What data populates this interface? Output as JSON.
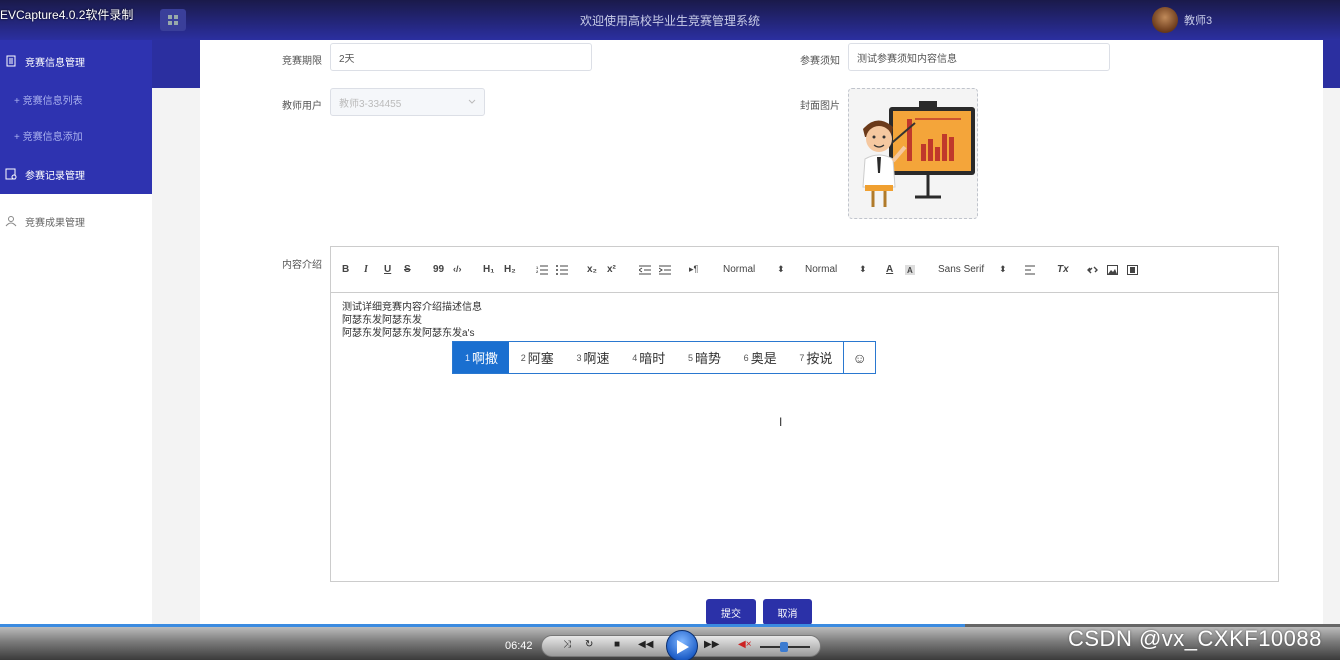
{
  "recorder": {
    "title": "EVCapture4.0.2软件录制"
  },
  "header": {
    "welcome": "欢迎使用高校毕业生竞赛管理系统",
    "user": "教师3"
  },
  "sidebar": {
    "items": [
      {
        "label": "竞赛信息管理"
      },
      {
        "label": "+ 竞赛信息列表"
      },
      {
        "label": "+ 竞赛信息添加"
      },
      {
        "label": "参赛记录管理"
      },
      {
        "label": "竞赛成果管理"
      }
    ]
  },
  "form": {
    "period_label": "竞赛期限",
    "period_value": "2天",
    "notice_label": "参赛须知",
    "notice_value": "测试参赛须知内容信息",
    "teacher_label": "教师用户",
    "teacher_value": "教师3-334455",
    "cover_label": "封面图片",
    "content_label": "内容介绍"
  },
  "editor": {
    "toolbar": {
      "bold": "B",
      "italic": "I",
      "underline": "U",
      "strike": "S",
      "quote": "99",
      "code": "‹/›",
      "h1": "H₁",
      "h2": "H₂",
      "sub": "x₂",
      "sup": "x²",
      "dir": "▸¶",
      "size": "Normal",
      "header": "Normal",
      "font": "Sans Serif",
      "color": "A",
      "clean": "Tx"
    },
    "lines": [
      "测试详细竞赛内容介绍描述信息",
      "阿瑟东发阿瑟东发",
      "阿瑟东发阿瑟东发阿瑟东发a's"
    ]
  },
  "ime": {
    "candidates": [
      {
        "num": "1",
        "text": "啊撒"
      },
      {
        "num": "2",
        "text": "阿塞"
      },
      {
        "num": "3",
        "text": "啊速"
      },
      {
        "num": "4",
        "text": "暗时"
      },
      {
        "num": "5",
        "text": "暗势"
      },
      {
        "num": "6",
        "text": "奥是"
      },
      {
        "num": "7",
        "text": "按说"
      }
    ]
  },
  "buttons": {
    "submit": "提交",
    "cancel": "取消"
  },
  "player": {
    "time": "06:42",
    "progress": 0.72
  },
  "watermark": "CSDN @vx_CXKF10088"
}
